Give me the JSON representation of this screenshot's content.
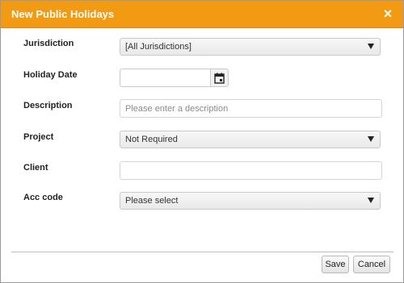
{
  "dialog": {
    "title": "New Public Holidays",
    "close_icon": "close-icon",
    "close_glyph": "×"
  },
  "form": {
    "jurisdiction": {
      "label": "Jurisdiction",
      "value": "[All Jurisdictions]"
    },
    "holiday_date": {
      "label": "Holiday Date",
      "value": "",
      "icon": "calendar-icon"
    },
    "description": {
      "label": "Description",
      "value": "",
      "placeholder": "Please enter a description"
    },
    "project": {
      "label": "Project",
      "value": "Not Required"
    },
    "client": {
      "label": "Client",
      "value": ""
    },
    "acc_code": {
      "label": "Acc code",
      "value": "Please select"
    }
  },
  "footer": {
    "save_label": "Save",
    "cancel_label": "Cancel"
  },
  "colors": {
    "titlebar": "#f29b12",
    "title_text": "#ffffff"
  }
}
